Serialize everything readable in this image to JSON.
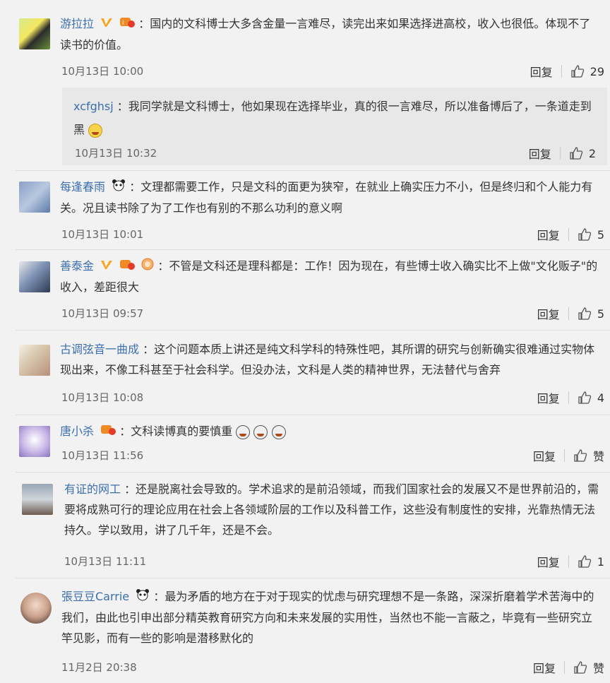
{
  "colors": {
    "name": "#3c6fad",
    "time": "#666666",
    "text": "#333333",
    "background": "#f2f2f2"
  },
  "comments": [
    {
      "id": "c1",
      "name": "游拉拉",
      "text": "：国内的文科博士大多含金量一言难尽，读完出来如果选择进高校，收入也很低。体现不了读书的价值。",
      "time": "10月13日 10:00",
      "reply": "回复",
      "likes": "29",
      "badges": [
        "verified-v-icon",
        "member-badge-icon"
      ]
    },
    {
      "id": "r1",
      "name": "xcfghsj",
      "text": "：我同学就是文科博士，他如果现在选择毕业，真的很一言难尽，所以准备博后了，一条道走到黑",
      "time": "10月13日 10:32",
      "reply": "回复",
      "likes": "2",
      "emoji": "laugh-cry-emoji"
    },
    {
      "id": "c2",
      "name": "每逢春雨",
      "text": "：文理都需要工作，只是文科的面更为狭窄，在就业上确实压力不小，但是终归和个人能力有关。况且读书除了为了工作也有别的不那么功利的意义啊",
      "time": "10月13日 10:01",
      "reply": "回复",
      "likes": "5",
      "badges": [
        "panda-icon"
      ]
    },
    {
      "id": "c3",
      "name": "善泰金",
      "text": "：不管是文科还是理科都是：工作！因为现在，有些博士收入确实比不上做\"文化贩子\"的收入，差距很大",
      "time": "10月13日 09:57",
      "reply": "回复",
      "likes": "5",
      "badges": [
        "verified-v-icon",
        "member-badge-icon",
        "fan-badge-icon"
      ]
    },
    {
      "id": "c4",
      "name": "古调弦音一曲成",
      "text": "：这个问题本质上讲还是纯文科学科的特殊性吧，其所谓的研究与创新确实很难通过实物体现出来，不像工科甚至于社会科学。但没办法，文科是人类的精神世界，无法替代与舍弃",
      "time": "10月13日 10:08",
      "reply": "回复",
      "likes": "4"
    },
    {
      "id": "c5",
      "name": "唐小杀",
      "text": "：文科读博真的要慎重",
      "time": "10月13日 11:56",
      "reply": "回复",
      "likes": "赞",
      "badges": [
        "member-badge-icon"
      ]
    },
    {
      "id": "c6",
      "name": "有证的网工",
      "text": "：还是脱离社会导致的。学术追求的是前沿领域，而我们国家社会的发展又不是世界前沿的，需要将成熟可行的理论应用在社会上各领域阶层的工作以及科普工作，这些没有制度性的安排，光靠热情无法持久。学以致用，讲了几千年，还是不会。",
      "time": "10月13日 11:11",
      "reply": "回复",
      "likes": "1"
    },
    {
      "id": "c7",
      "name": "張豆豆Carrie",
      "text": "：最为矛盾的地方在于对于现实的忧虑与研究理想不是一条路，深深折磨着学术苦海中的我们，由此也引申出部分精英教育研究方向和未来发展的实用性，当然也不能一言蔽之，毕竟有一些研究立竿见影，而有一些的影响是潜移默化的",
      "time": "11月2日 20:38",
      "reply": "回复",
      "likes": "赞",
      "badges": [
        "panda-icon"
      ]
    }
  ]
}
